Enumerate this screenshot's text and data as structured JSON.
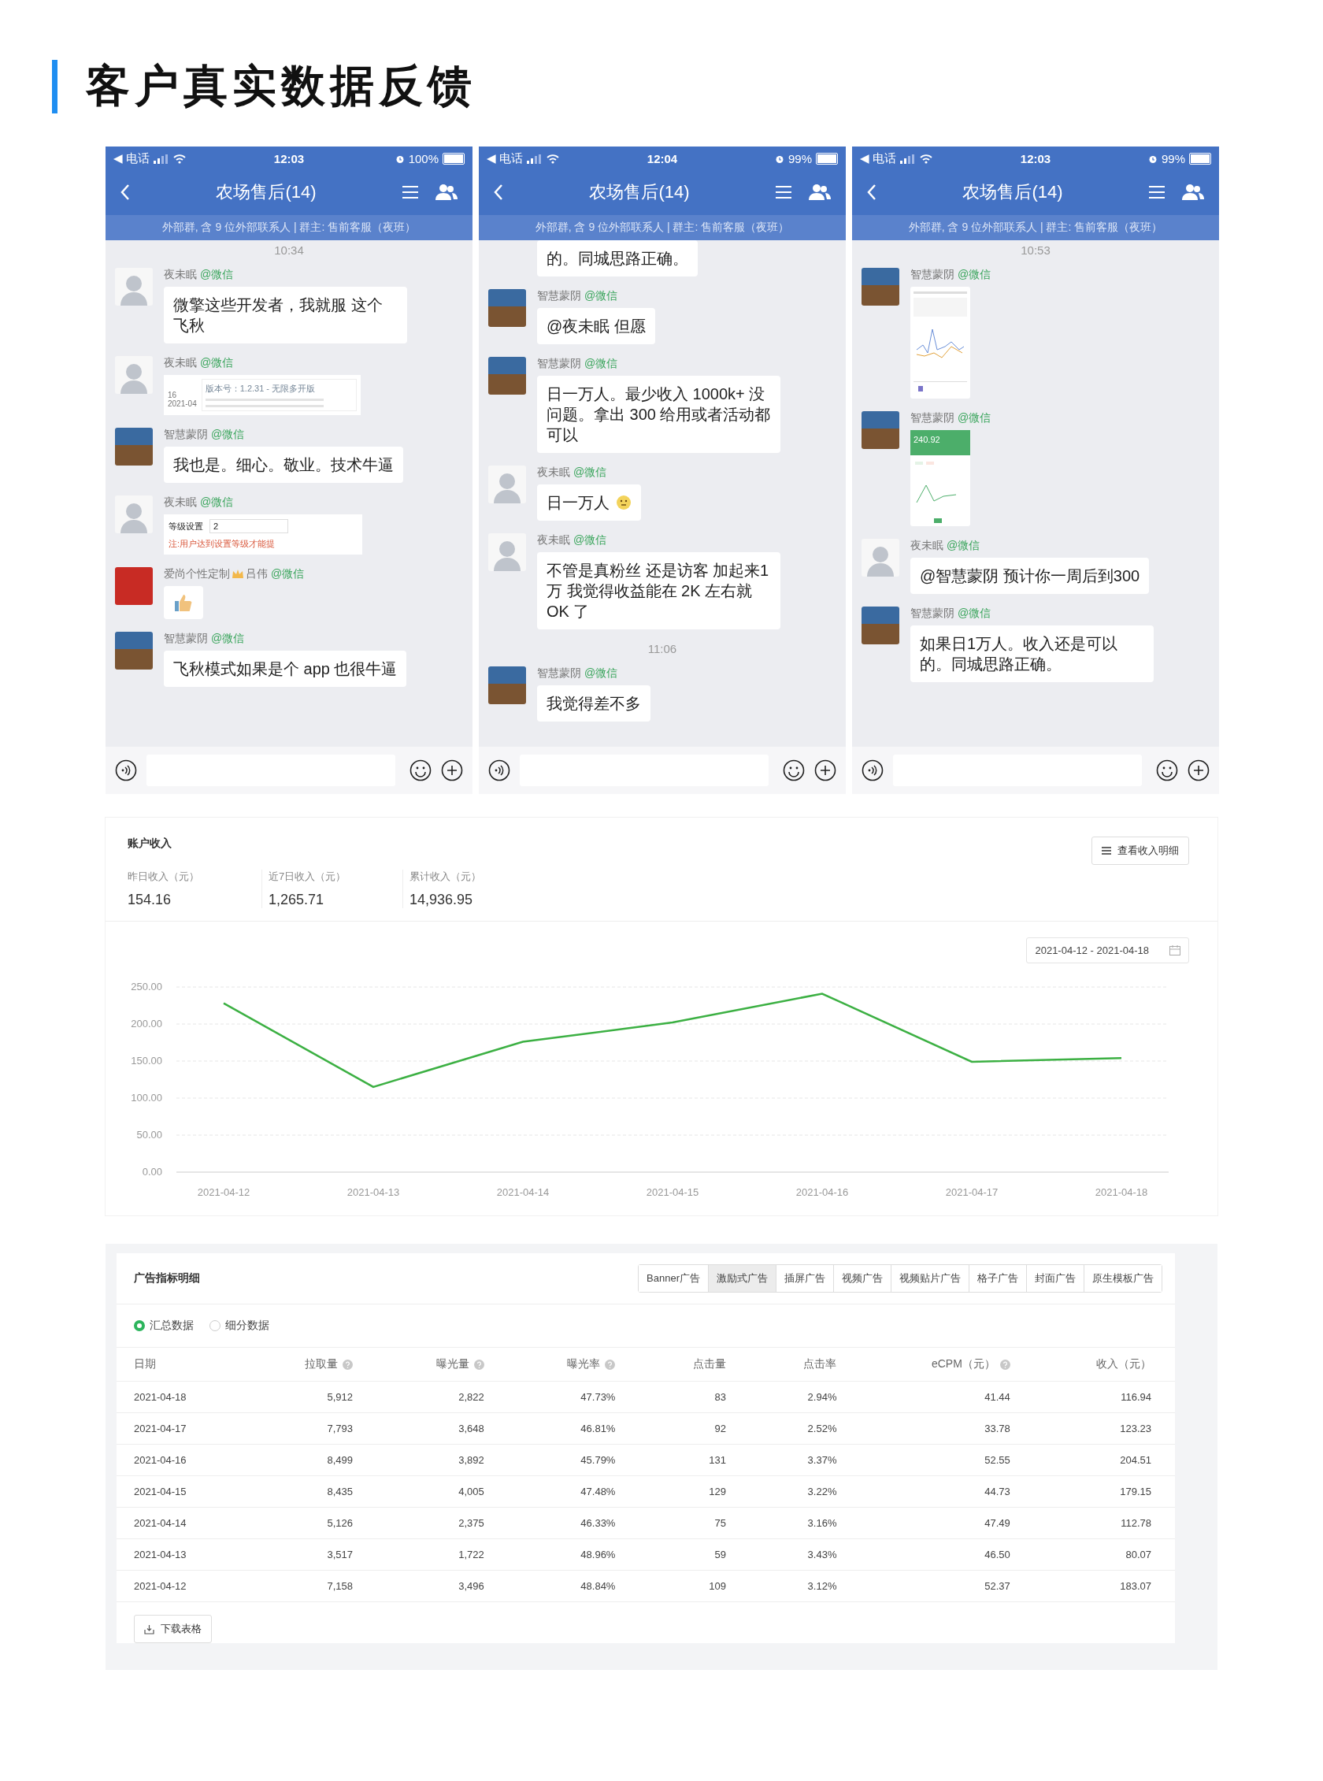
{
  "page_title": "客户真实数据反馈",
  "phones": [
    {
      "status": {
        "carrier": "◀ 电话",
        "time": "12:03",
        "battery": "100%"
      },
      "title": "农场售后(14)",
      "subtitle": "外部群, 含 9 位外部联系人 | 群主: 售前客服（夜班）",
      "messages": [
        {
          "kind": "time",
          "text": "10:34"
        },
        {
          "kind": "text",
          "avatar": {
            "kind": "cartoon"
          },
          "sender": "夜未眠",
          "tag": "@微信",
          "text": "微擎这些开发者，我就服 这个飞秋"
        },
        {
          "kind": "version_shot",
          "avatar": {
            "kind": "cartoon"
          },
          "sender": "夜未眠",
          "tag": "@微信",
          "day": "16",
          "month": "2021-04",
          "version": "版本号：1.2.31 - 无限多开版"
        },
        {
          "kind": "text",
          "avatar": {
            "kind": "road"
          },
          "sender": "智慧蒙阴",
          "tag": "@微信",
          "text": "我也是。细心。敬业。技术牛逼"
        },
        {
          "kind": "setting_shot",
          "avatar": {
            "kind": "cartoon"
          },
          "sender": "夜未眠",
          "tag": "@微信",
          "label": "等级设置",
          "value": "2",
          "note": "注:用户达到设置等级才能提"
        },
        {
          "kind": "sticker",
          "avatar": {
            "kind": "cola"
          },
          "sender": "爱尚个性定制",
          "badge": true,
          "sender_suffix": "吕伟",
          "tag": "@微信"
        },
        {
          "kind": "text",
          "avatar": {
            "kind": "road"
          },
          "sender": "智慧蒙阴",
          "tag": "@微信",
          "text": "飞秋模式如果是个 app 也很牛逼"
        }
      ]
    },
    {
      "status": {
        "carrier": "◀ 电话",
        "time": "12:04",
        "battery": "99%"
      },
      "title": "农场售后(14)",
      "subtitle": "外部群, 含 9 位外部联系人 | 群主: 售前客服（夜班）",
      "messages": [
        {
          "kind": "partial",
          "text": "的。同城思路正确。"
        },
        {
          "kind": "text",
          "avatar": {
            "kind": "road"
          },
          "sender": "智慧蒙阴",
          "tag": "@微信",
          "text": "@夜未眠 但愿"
        },
        {
          "kind": "text",
          "avatar": {
            "kind": "road"
          },
          "sender": "智慧蒙阴",
          "tag": "@微信",
          "text": "日一万人。最少收入 1000k+ 没问题。拿出 300 给用或者活动都可以"
        },
        {
          "kind": "text",
          "avatar": {
            "kind": "cartoon"
          },
          "sender": "夜未眠",
          "tag": "@微信",
          "text": "日一万人",
          "emoji": true
        },
        {
          "kind": "text",
          "avatar": {
            "kind": "cartoon"
          },
          "sender": "夜未眠",
          "tag": "@微信",
          "text": "不管是真粉丝 还是访客 加起来1万  我觉得收益能在 2K 左右就 OK 了"
        },
        {
          "kind": "time",
          "text": "11:06"
        },
        {
          "kind": "text",
          "avatar": {
            "kind": "road"
          },
          "sender": "智慧蒙阴",
          "tag": "@微信",
          "text": "我觉得差不多"
        }
      ]
    },
    {
      "status": {
        "carrier": "◀ 电话",
        "time": "12:03",
        "battery": "99%"
      },
      "title": "农场售后(14)",
      "subtitle": "外部群, 含 9 位外部联系人 | 群主: 售前客服（夜班）",
      "messages": [
        {
          "kind": "time",
          "text": "10:53"
        },
        {
          "kind": "app_shot",
          "avatar": {
            "kind": "road"
          },
          "sender": "智慧蒙阴",
          "tag": "@微信"
        },
        {
          "kind": "income_shot",
          "avatar": {
            "kind": "road"
          },
          "sender": "智慧蒙阴",
          "tag": "@微信",
          "amount": "240.92"
        },
        {
          "kind": "text",
          "avatar": {
            "kind": "cartoon"
          },
          "sender": "夜未眠",
          "tag": "@微信",
          "text": "@智慧蒙阴 预计你一周后到300"
        },
        {
          "kind": "text",
          "avatar": {
            "kind": "road"
          },
          "sender": "智慧蒙阴",
          "tag": "@微信",
          "text": "如果日1万人。收入还是可以的。同城思路正确。"
        }
      ]
    }
  ],
  "income": {
    "title": "账户收入",
    "detail_button": "查看收入明细",
    "stats": [
      {
        "label": "昨日收入（元）",
        "value": "154.16"
      },
      {
        "label": "近7日收入（元）",
        "value": "1,265.71"
      },
      {
        "label": "累计收入（元）",
        "value": "14,936.95"
      }
    ],
    "date_range": "2021-04-12 - 2021-04-18",
    "chart_data": {
      "type": "line",
      "categories": [
        "2021-04-12",
        "2021-04-13",
        "2021-04-14",
        "2021-04-15",
        "2021-04-16",
        "2021-04-17",
        "2021-04-18"
      ],
      "series": [
        {
          "color": "#3cb043",
          "values": [
            228,
            115,
            176,
            202,
            241,
            149,
            154
          ]
        }
      ],
      "ylim": [
        0,
        250
      ],
      "grid": true,
      "yticks": [
        {
          "value": 0,
          "label": "0.00"
        },
        {
          "value": 50,
          "label": "50.00"
        },
        {
          "value": 100,
          "label": "100.00"
        },
        {
          "value": 150,
          "label": "150.00"
        },
        {
          "value": 200,
          "label": "200.00"
        },
        {
          "value": 250,
          "label": "250.00"
        }
      ]
    }
  },
  "ads": {
    "title": "广告指标明细",
    "tabs": [
      {
        "label": "Banner广告",
        "selected": false
      },
      {
        "label": "激励式广告",
        "selected": true
      },
      {
        "label": "插屏广告",
        "selected": false
      },
      {
        "label": "视频广告",
        "selected": false
      },
      {
        "label": "视频贴片广告",
        "selected": false
      },
      {
        "label": "格子广告",
        "selected": false
      },
      {
        "label": "封面广告",
        "selected": false
      },
      {
        "label": "原生模板广告",
        "selected": false
      }
    ],
    "radios": [
      {
        "label": "汇总数据",
        "selected": true
      },
      {
        "label": "细分数据",
        "selected": false
      }
    ],
    "columns": [
      {
        "label": "日期",
        "help": false
      },
      {
        "label": "拉取量",
        "help": true
      },
      {
        "label": "曝光量",
        "help": true
      },
      {
        "label": "曝光率",
        "help": true
      },
      {
        "label": "点击量",
        "help": false
      },
      {
        "label": "点击率",
        "help": false
      },
      {
        "label": "eCPM（元）",
        "help": true
      },
      {
        "label": "收入（元）",
        "help": false
      }
    ],
    "rows": [
      [
        "2021-04-18",
        "5,912",
        "2,822",
        "47.73%",
        "83",
        "2.94%",
        "41.44",
        "116.94"
      ],
      [
        "2021-04-17",
        "7,793",
        "3,648",
        "46.81%",
        "92",
        "2.52%",
        "33.78",
        "123.23"
      ],
      [
        "2021-04-16",
        "8,499",
        "3,892",
        "45.79%",
        "131",
        "3.37%",
        "52.55",
        "204.51"
      ],
      [
        "2021-04-15",
        "8,435",
        "4,005",
        "47.48%",
        "129",
        "3.22%",
        "44.73",
        "179.15"
      ],
      [
        "2021-04-14",
        "5,126",
        "2,375",
        "46.33%",
        "75",
        "3.16%",
        "47.49",
        "112.78"
      ],
      [
        "2021-04-13",
        "3,517",
        "1,722",
        "48.96%",
        "59",
        "3.43%",
        "46.50",
        "80.07"
      ],
      [
        "2021-04-12",
        "7,158",
        "3,496",
        "48.84%",
        "109",
        "3.12%",
        "52.37",
        "183.07"
      ]
    ],
    "download_button": "下载表格"
  }
}
